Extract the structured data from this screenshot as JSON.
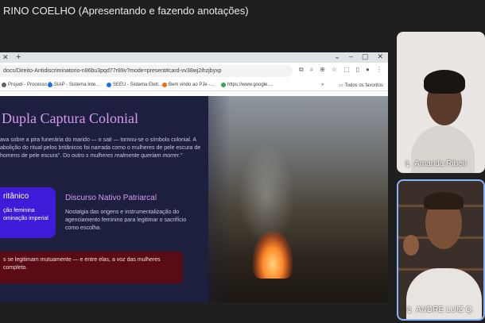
{
  "meeting": {
    "title": "RINO COELHO (Apresentando e fazendo anotações)"
  },
  "browser": {
    "tab_close": "✕",
    "new_tab": "+",
    "window_controls": [
      "⌄",
      "–",
      "▢",
      "✕"
    ],
    "url": "docs/Direito-Antidiscriminatorio-n86bu3pqd77r89v?mode=present#card-vv38wj2ihzjbyxp",
    "bookmarks": [
      {
        "label": "Projudi - Processo E...",
        "color": "#5f6368"
      },
      {
        "label": "SIAP - Sistema Inte...",
        "color": "#1a73e8"
      },
      {
        "label": "SEEU - Sistema Eletr...",
        "color": "#1a73e8"
      },
      {
        "label": "Bem vindo ao PJe -...",
        "color": "#e8710a"
      },
      {
        "label": "https://www.google....",
        "color": "#34a853"
      }
    ],
    "bookmarks_more": "»",
    "all_bookmarks": "Todos os favoritos"
  },
  "slide": {
    "title": "Dupla Captura Colonial",
    "intro_1": "ava sobre a pira funerária do marido — o ",
    "intro_sati": "sati",
    "intro_2": " — tornou-se o símbolo colonial. A abolição do ritual pelos britânicos foi narrada como o mulheres de pele escura de homens de pele escura\". Do outro ",
    "intro_3": "s mulheres realmente queriam morrer.\"",
    "card_left_title": "ritânico",
    "card_left_body": "ção feminina\nominação imperial",
    "card_mid_title": "Discurso Nativo Patriarcal",
    "card_mid_body": "Nostalgia das origens e instrumentalização do agenciamento feminino para legitimar o sacrifício como escolha.",
    "bottom_text": "s se legitimam mutuamente — e entre elas, a voz das mulheres\ncompleto."
  },
  "participants": [
    {
      "name": "Amanda Ribeir",
      "mic": "🎙"
    },
    {
      "name": "ANDRE LUIZ Q.",
      "mic": "🎙"
    }
  ]
}
